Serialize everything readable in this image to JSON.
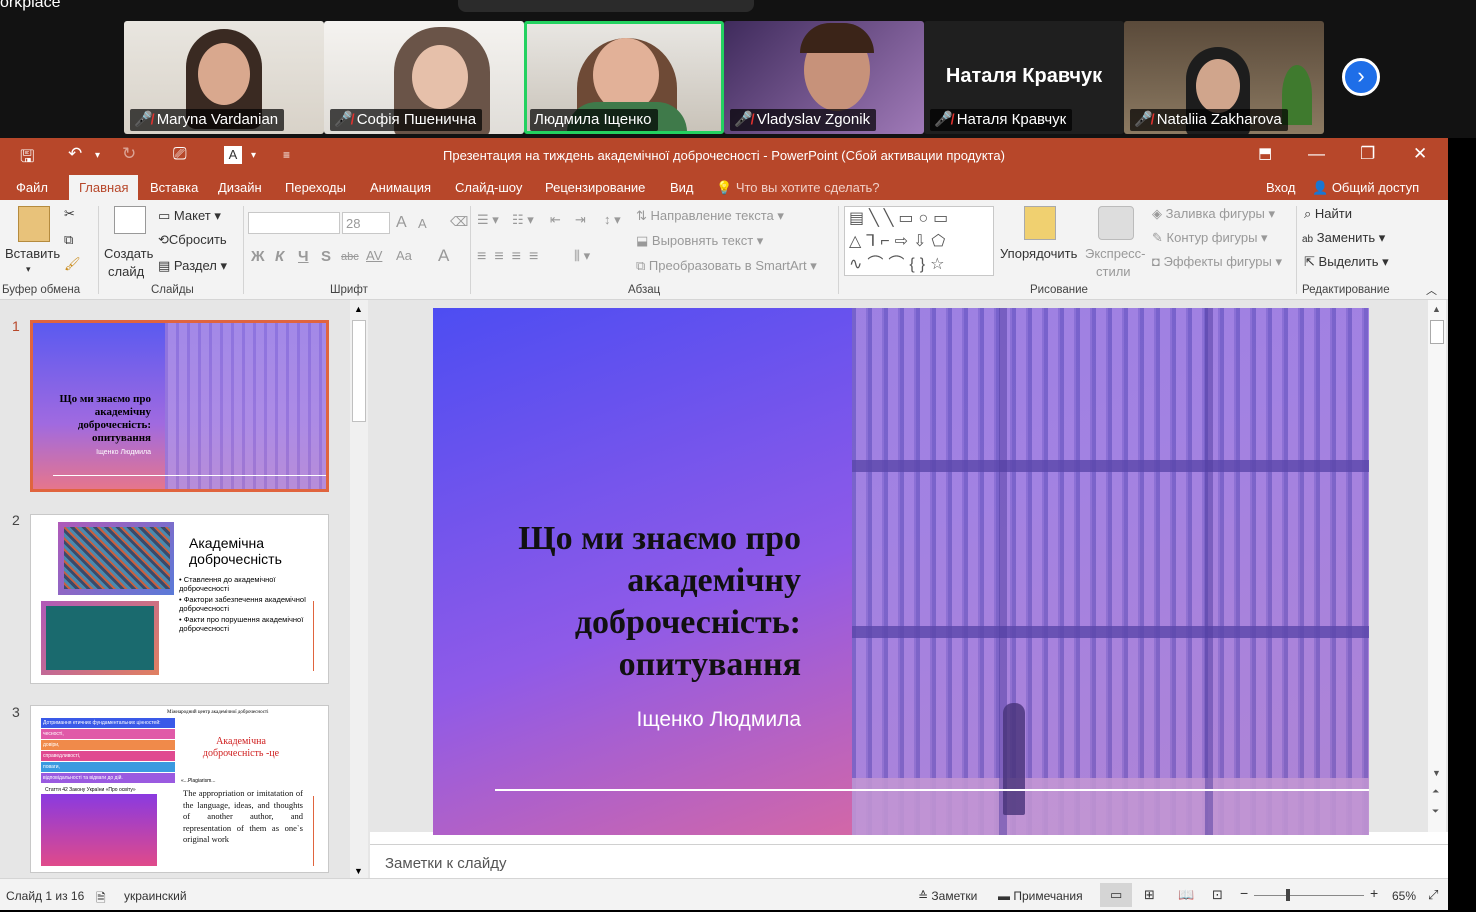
{
  "zoom": {
    "top_left_text": "orkplace",
    "participants": [
      {
        "name": "Maryna Vardanian",
        "muted": true
      },
      {
        "name": "Софія Пшенична",
        "muted": true
      },
      {
        "name": "Людмила Іщенко",
        "muted": false,
        "active_speaker": true
      },
      {
        "name": "Vladyslav Zgonik",
        "muted": true
      },
      {
        "name": "Наталя Кравчук",
        "muted": true,
        "video_off_label": "Наталя Кравчук"
      },
      {
        "name": "Nataliia Zakharova",
        "muted": true
      }
    ],
    "next_icon": "chevron-right-icon"
  },
  "ppt": {
    "title": "Презентация на тиждень академічної доброчесності  -  PowerPoint (Сбой активации продукта)",
    "menu": [
      "Файл",
      "Главная",
      "Вставка",
      "Дизайн",
      "Переходы",
      "Анимация",
      "Слайд-шоу",
      "Рецензирование",
      "Вид"
    ],
    "tell_me": "Что вы хотите сделать?",
    "login": "Вход",
    "share": "Общий доступ",
    "ribbon": {
      "paste": "Вставить",
      "clipboard_group": "Буфер обмена",
      "new_slide_1": "Создать",
      "new_slide_2": "слайд",
      "layout": "Макет",
      "reset": "Сбросить",
      "section": "Раздел",
      "slides_group": "Слайды",
      "font_size": "28",
      "bold": "Ж",
      "italic": "К",
      "underline": "Ч",
      "shadow": "S",
      "strike": "abc",
      "spacing": "AV",
      "case": "Aa",
      "font_group": "Шрифт",
      "text_direction": "Направление текста",
      "align_text": "Выровнять текст",
      "smartart": "Преобразовать в SmartArt",
      "paragraph_group": "Абзац",
      "arrange": "Упорядочить",
      "quick_styles_1": "Экспресс-",
      "quick_styles_2": "стили",
      "shape_fill": "Заливка фигуры",
      "shape_outline": "Контур фигуры",
      "shape_effects": "Эффекты фигуры",
      "drawing_group": "Рисование",
      "find": "Найти",
      "replace": "Заменить",
      "select": "Выделить",
      "editing_group": "Редактирование"
    },
    "thumbs": {
      "n1": "1",
      "n2": "2",
      "n3": "3",
      "t1_title": "Що ми знаємо про академічну доброчесність: опитування",
      "t1_author": "Іщенко Людмила",
      "t2_title": "Академічна доброчесність",
      "t2_b1": "Ставлення до академічної доброчесності",
      "t2_b2": "Фактори забезпечення академічної доброчесності",
      "t2_b3": "Факти про порушення академічної доброчесності",
      "t3_head": "Міжнародний центр академічної доброчесності",
      "t3_rows": [
        "Дотримання етичних фундаментальних цінностей:",
        "чесності,",
        "довіри,",
        "справедливості,",
        "поваги,",
        "відповідальності та відваги до дій."
      ],
      "t3_title": "Академічна доброчесність -це",
      "t3_ref": "«...Plagiarism...",
      "t3_law": "Стаття 42 Закону України «Про освіту»",
      "t3_en": "The appropriation or imitatation of the language, ideas, and thoughts of another author, and representation of them as one`s original work"
    },
    "slide": {
      "title": "Що ми знаємо про академічну доброчесність: опитування",
      "author": "Іщенко Людмила"
    },
    "notes_placeholder": "Заметки к слайду",
    "status": {
      "slide": "Слайд 1 из 16",
      "lang": "украинский",
      "notes": "Заметки",
      "comments": "Примечания",
      "zoom": "65%"
    }
  }
}
